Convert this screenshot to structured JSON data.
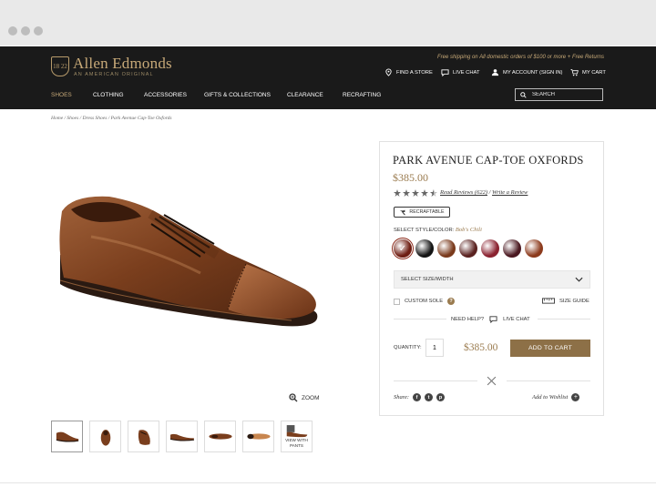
{
  "brand": {
    "name": "Allen Edmonds",
    "tagline": "AN AMERICAN ORIGINAL",
    "badge_text": "18 22",
    "accent": "#c7a978"
  },
  "header": {
    "promo": "Free shipping on All domestic orders of $100 or more + Free Returns",
    "utility": [
      {
        "label": "FIND A STORE",
        "icon": "map-pin-icon"
      },
      {
        "label": "LIVE CHAT",
        "icon": "chat-icon"
      },
      {
        "label": "MY ACCOUNT (Sign in)",
        "icon": "user-icon"
      },
      {
        "label": "MY CART",
        "icon": "cart-icon"
      }
    ],
    "nav": [
      {
        "label": "SHOES",
        "active": true
      },
      {
        "label": "CLOTHING"
      },
      {
        "label": "ACCESSORIES"
      },
      {
        "label": "GIFTS & COLLECTIONS"
      },
      {
        "label": "CLEARANCE"
      },
      {
        "label": "RECRAFTING"
      }
    ],
    "search_placeholder": "SEARCH"
  },
  "breadcrumb": [
    "Home",
    "Shoes",
    "Dress Shoes",
    "Park Avenue Cap-Toe Oxfords"
  ],
  "breadcrumb_sep": " / ",
  "product": {
    "title": "PARK AVENUE CAP-TOE OXFORDS",
    "price": "$385.00",
    "rating": 4.5,
    "reviews_link": "Read Reviews (622)",
    "reviews_sep": "/",
    "write_review": "Write a Review",
    "badge": "RECRAFTABLE",
    "style_label": "SELECT STYLE/COLOR:",
    "style_value": "Bob's Chili",
    "swatches": [
      "#6e1d12",
      "#141414",
      "#7a3a1c",
      "#5a2220",
      "#8a2230",
      "#4a1820",
      "#8c3a1c"
    ],
    "size_select": "SELECT SIZE/WIDTH",
    "custom_sole": "CUSTOM SOLE",
    "size_guide": "SIZE GUIDE",
    "need_help": "NEED HELP?",
    "live_chat": "LIVE CHAT",
    "quantity_label": "QUANTITY:",
    "quantity_value": "1",
    "cart_price": "$385.00",
    "add_to_cart": "ADD TO CART",
    "share_label": "Share:",
    "wishlist": "Add to Wishlist"
  },
  "gallery": {
    "zoom_label": "ZOOM",
    "view_with_pants": "VIEW WITH PANTS"
  }
}
